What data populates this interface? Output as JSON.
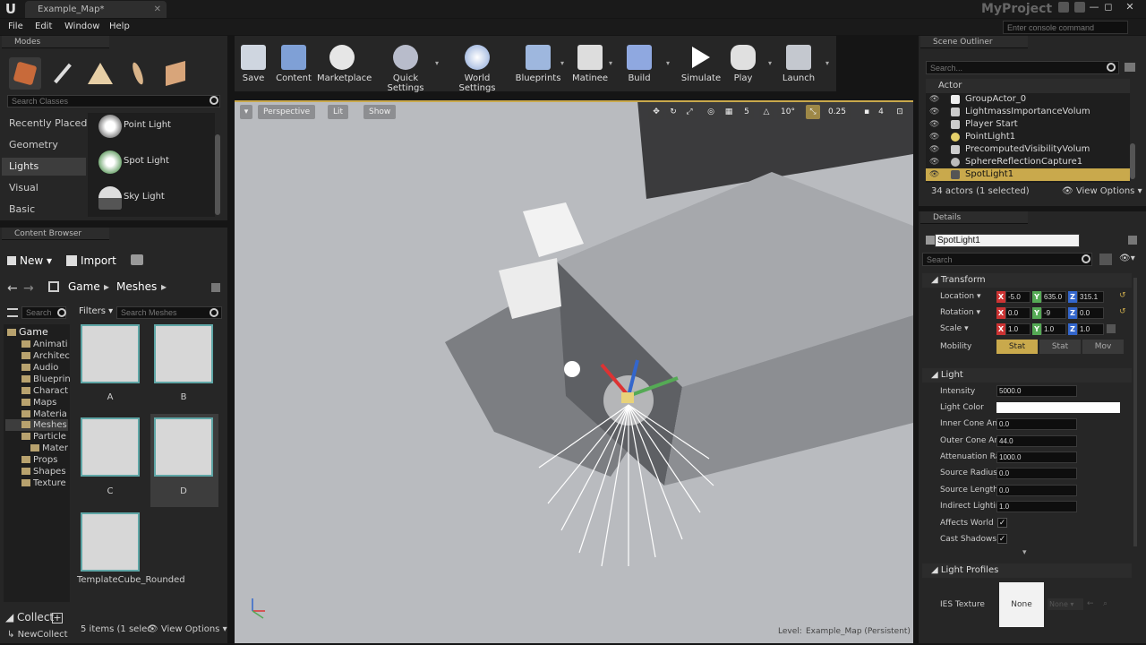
{
  "titlebar": {
    "tab": "Example_Map*",
    "tab_close": "✕",
    "project": "MyProject",
    "min": "—",
    "max": "◻",
    "close": "✕"
  },
  "menu": {
    "items": [
      "File",
      "Edit",
      "Window",
      "Help"
    ]
  },
  "console": {
    "placeholder": "Enter console command"
  },
  "modes": {
    "tab": "Modes",
    "search_placeholder": "Search Classes",
    "categories": [
      "Recently Placed",
      "Geometry",
      "Lights",
      "Visual",
      "Basic"
    ],
    "active_category": "Lights",
    "items": [
      "Point Light",
      "Spot Light",
      "Sky Light"
    ]
  },
  "toolbar": {
    "buttons": [
      "Save",
      "Content",
      "Marketplace",
      "Quick Settings",
      "World Settings",
      "Blueprints",
      "Matinee",
      "Build",
      "Simulate",
      "Play",
      "Launch"
    ]
  },
  "viewport": {
    "perspective": "Perspective",
    "lit": "Lit",
    "show": "Show",
    "grid_num": "5",
    "angle": "10°",
    "scale": "0.25",
    "cam": "4",
    "level_label": "Level:",
    "level_name": "Example_Map (Persistent)"
  },
  "outliner": {
    "tab": "Scene Outliner",
    "search_placeholder": "Search...",
    "column": "Actor",
    "rows": [
      "GroupActor_0",
      "LightmassImportanceVolum",
      "Player Start",
      "PointLight1",
      "PrecomputedVisibilityVolum",
      "SphereReflectionCapture1",
      "SpotLight1"
    ],
    "selected": "SpotLight1",
    "count": "34 actors (1 selected)",
    "view_options": "View Options"
  },
  "details": {
    "tab": "Details",
    "name": "SpotLight1",
    "search_placeholder": "Search",
    "transform": "Transform",
    "location_label": "Location",
    "location": [
      "-5.0",
      "635.0",
      "315.1"
    ],
    "rotation_label": "Rotation",
    "rotation": [
      "0.0",
      "-9",
      "0.0"
    ],
    "scale_label": "Scale",
    "scale": [
      "1.0",
      "1.0",
      "1.0"
    ],
    "mobility_label": "Mobility",
    "mobility": [
      "Stat",
      "Stat",
      "Mov"
    ],
    "light_section": "Light",
    "props": [
      {
        "label": "Intensity",
        "value": "5000.0"
      },
      {
        "label": "Light Color",
        "value": ""
      },
      {
        "label": "Inner Cone Anc",
        "value": "0.0"
      },
      {
        "label": "Outer Cone An",
        "value": "44.0"
      },
      {
        "label": "Attenuation Ra",
        "value": "1000.0"
      },
      {
        "label": "Source Radius",
        "value": "0.0"
      },
      {
        "label": "Source Length",
        "value": "0.0"
      },
      {
        "label": "Indirect Lightin",
        "value": "1.0"
      }
    ],
    "affects_world": "Affects World",
    "cast_shadows": "Cast Shadows",
    "light_profiles": "Light Profiles",
    "ies_label": "IES Texture",
    "ies_value": "None",
    "ies_dropdown": "None"
  },
  "content": {
    "tab": "Content Browser",
    "new": "New",
    "import": "Import",
    "path": [
      "Game",
      "Meshes"
    ],
    "search_paths": "Search",
    "filters": "Filters",
    "search_meshes": "Search Meshes",
    "tree_root": "Game",
    "folders": [
      "Animati",
      "Architec",
      "Audio",
      "Blueprin",
      "Charact",
      "Maps",
      "Materia",
      "Meshes",
      "Particle",
      "Mater",
      "Props",
      "Shapes",
      "Texture"
    ],
    "assets": [
      "A",
      "B",
      "C",
      "D",
      "TemplateCube_Rounded"
    ],
    "count": "5 items (1 selec",
    "view_options": "View Options",
    "collections": "Collect",
    "new_collection": "NewCollect"
  },
  "colors": {
    "accent": "#c9a94c",
    "x_axis": "#c33",
    "y_axis": "#5a5",
    "z_axis": "#36c"
  }
}
